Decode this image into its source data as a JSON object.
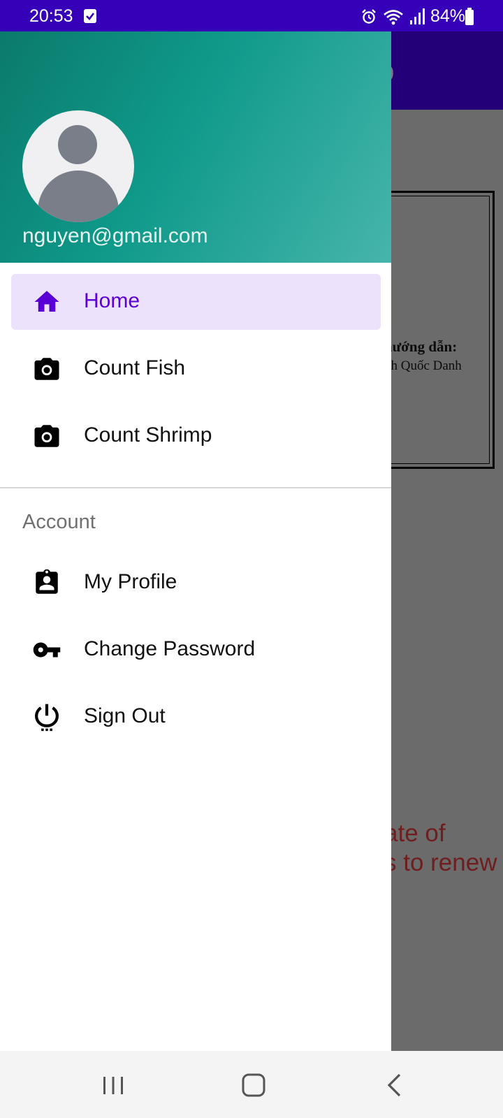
{
  "status_bar": {
    "time": "20:53",
    "battery": "84%",
    "icons": [
      "checkbox-notification-icon",
      "alarm-icon",
      "wifi-icon",
      "signal-icon",
      "battery-icon"
    ]
  },
  "background_app": {
    "toolbar_title_fragment": "p",
    "doc_line1": "hướng dẫn:",
    "doc_line2": "nh Quốc Danh",
    "notice_line1": "ate of",
    "notice_line2": "s to renew"
  },
  "drawer": {
    "header": {
      "email": "nguyen@gmail.com"
    },
    "main_items": [
      {
        "label": "Home",
        "icon": "home-icon",
        "active": true
      },
      {
        "label": "Count Fish",
        "icon": "camera-icon",
        "active": false
      },
      {
        "label": "Count Shrimp",
        "icon": "camera-icon",
        "active": false
      }
    ],
    "account_section": {
      "title": "Account",
      "items": [
        {
          "label": "My Profile",
          "icon": "profile-badge-icon"
        },
        {
          "label": "Change Password",
          "icon": "key-icon"
        },
        {
          "label": "Sign Out",
          "icon": "power-icon"
        }
      ]
    }
  },
  "colors": {
    "status_bar": "#3500b8",
    "header_gradient_start": "#0b7a6c",
    "header_gradient_end": "#47b5ab",
    "active_item_bg": "#ece2fb",
    "active_item_fg": "#5a00d6",
    "scrim": "#6b6b6b"
  }
}
